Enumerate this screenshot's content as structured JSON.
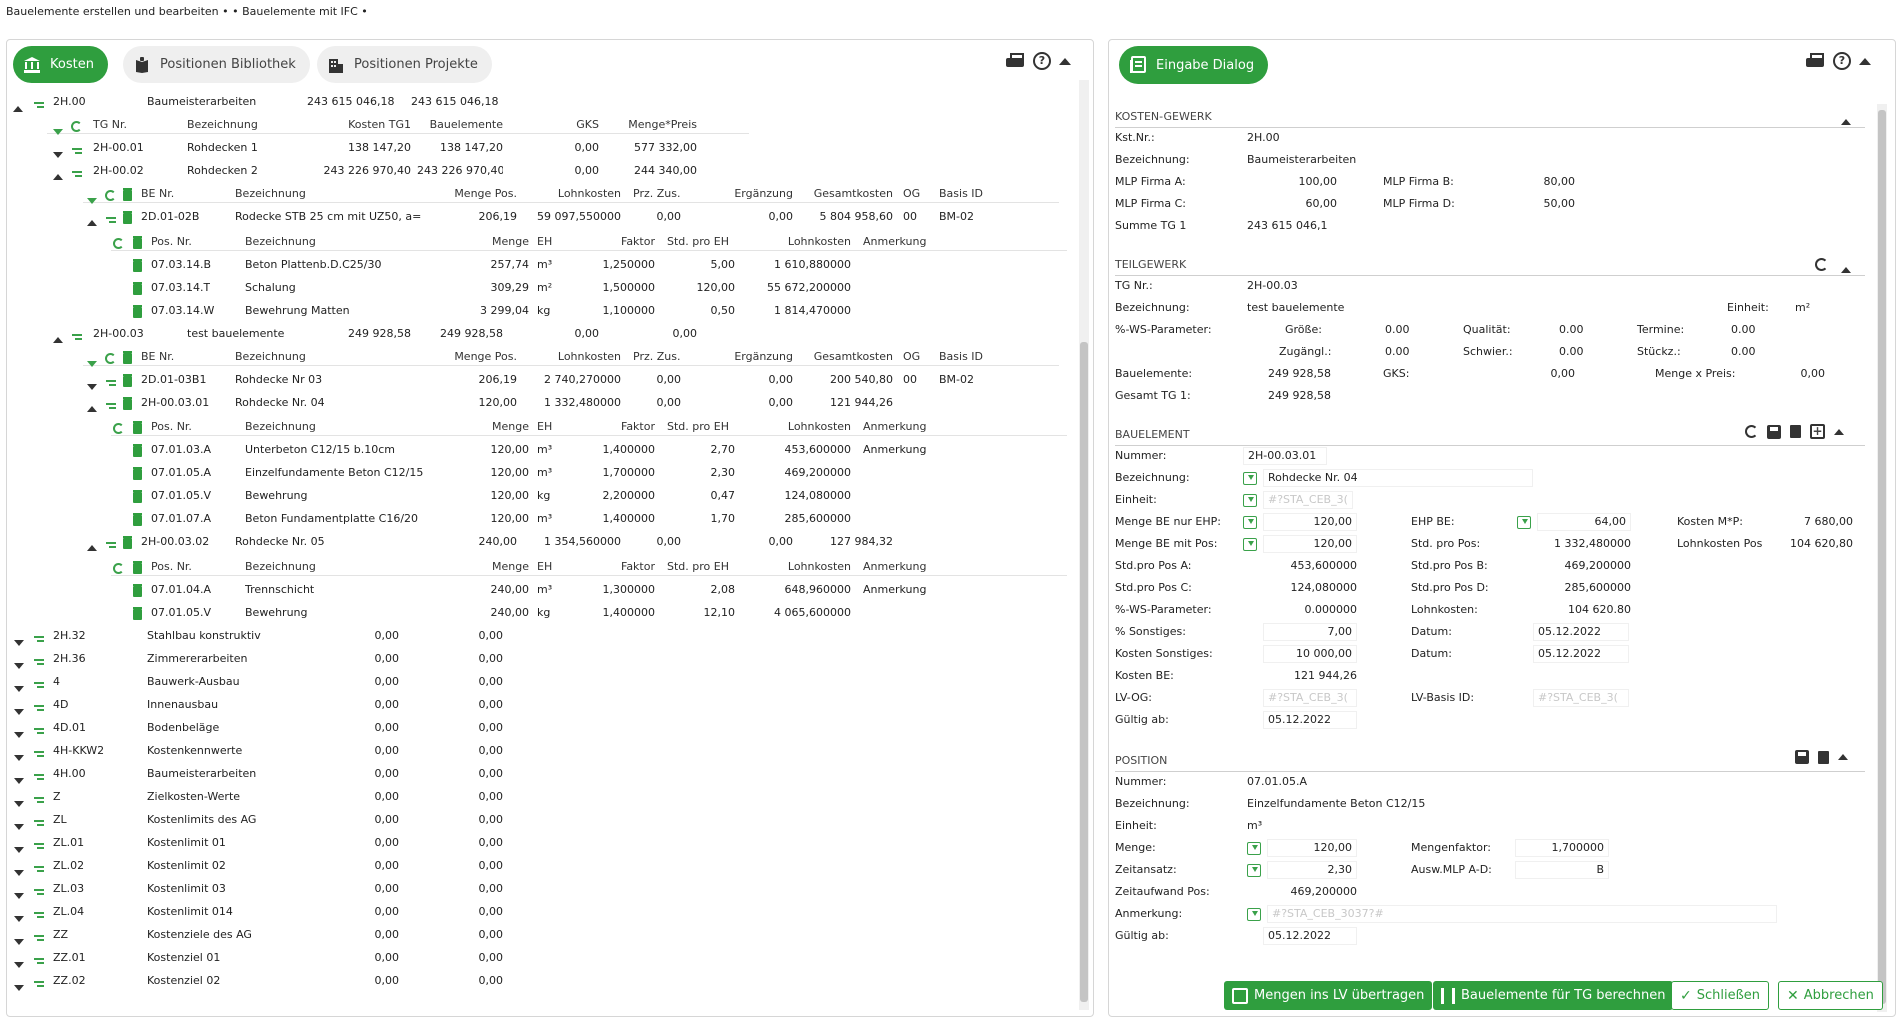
{
  "window": {
    "title": "Bauelemente erstellen und bearbeiten •  • Bauelemente mit IFC •"
  },
  "colors": {
    "accent": "#2f9e3e"
  },
  "left": {
    "tabs": [
      {
        "label": "Kosten",
        "icon": "bank-icon",
        "active": true
      },
      {
        "label": "Positionen Bibliothek",
        "icon": "book-icon",
        "active": false
      },
      {
        "label": "Positionen Projekte",
        "icon": "building-icon",
        "active": false
      }
    ],
    "root": {
      "id": "2H.00",
      "name": "Baumeisterarbeiten",
      "kosten": "243 615 046,18",
      "bauelemente": "243 615 046,18"
    },
    "tg_header": {
      "tg_nr": "TG Nr.",
      "bez": "Bezeichnung",
      "kosten": "Kosten TG1",
      "be": "Bauelemente",
      "gks": "GKS",
      "mp": "Menge*Preis"
    },
    "tg": [
      {
        "nr": "2H-00.01",
        "bez": "Rohdecken 1",
        "kosten": "138 147,20",
        "be": "138 147,20",
        "gks": "0,00",
        "mp": "577 332,00"
      },
      {
        "nr": "2H-00.02",
        "bez": "Rohdecken 2",
        "kosten": "243 226 970,40",
        "be": "243 226 970,40",
        "gks": "0,00",
        "mp": "244 340,00"
      },
      {
        "nr": "2H-00.03",
        "bez": "test bauelemente",
        "kosten": "249 928,58",
        "be": "249 928,58",
        "gks": "0,00",
        "mp": "0,00"
      }
    ],
    "be_header": {
      "nr": "BE Nr.",
      "bez": "Bezeichnung",
      "menge": "Menge Pos.",
      "lohn": "Lohnkosten",
      "prz": "Prz. Zus.",
      "erg": "Ergänzung",
      "ges": "Gesamtkosten",
      "og": "OG",
      "basis": "Basis ID"
    },
    "pos_header": {
      "nr": "Pos. Nr.",
      "bez": "Bezeichnung",
      "menge": "Menge",
      "eh": "EH",
      "faktor": "Faktor",
      "std": "Std. pro EH",
      "lohn": "Lohnkosten",
      "anm": "Anmerkung"
    },
    "be_a": {
      "nr": "2D.01-02B",
      "bez": "Rodecke STB 25 cm mit UZ50, a=",
      "menge": "206,19",
      "lohn": "59 097,550000",
      "prz": "0,00",
      "erg": "0,00",
      "ges": "5 804 958,60",
      "og": "00",
      "basis": "BM-02"
    },
    "pos_a": [
      {
        "nr": "07.03.14.B",
        "bez": "Beton Plattenb.D.C25/30",
        "menge": "257,74",
        "eh": "m³",
        "faktor": "1,250000",
        "std": "5,00",
        "lohn": "1 610,880000",
        "anm": ""
      },
      {
        "nr": "07.03.14.T",
        "bez": "Schalung",
        "menge": "309,29",
        "eh": "m²",
        "faktor": "1,500000",
        "std": "120,00",
        "lohn": "55 672,200000",
        "anm": ""
      },
      {
        "nr": "07.03.14.W",
        "bez": "Bewehrung Matten",
        "menge": "3 299,04",
        "eh": "kg",
        "faktor": "1,100000",
        "std": "0,50",
        "lohn": "1 814,470000",
        "anm": ""
      }
    ],
    "be_b": [
      {
        "nr": "2D.01-03B1",
        "bez": "Rohdecke Nr 03",
        "menge": "206,19",
        "lohn": "2 740,270000",
        "prz": "0,00",
        "erg": "0,00",
        "ges": "200 540,80",
        "og": "00",
        "basis": "BM-02"
      },
      {
        "nr": "2H-00.03.01",
        "bez": "Rohdecke Nr. 04",
        "menge": "120,00",
        "lohn": "1 332,480000",
        "prz": "0,00",
        "erg": "0,00",
        "ges": "121 944,26",
        "og": "",
        "basis": ""
      }
    ],
    "pos_b": [
      {
        "nr": "07.01.03.A",
        "bez": "Unterbeton C12/15 b.10cm",
        "menge": "120,00",
        "eh": "m³",
        "faktor": "1,400000",
        "std": "2,70",
        "lohn": "453,600000",
        "anm": "Anmerkung"
      },
      {
        "nr": "07.01.05.A",
        "bez": "Einzelfundamente Beton C12/15",
        "menge": "120,00",
        "eh": "m³",
        "faktor": "1,700000",
        "std": "2,30",
        "lohn": "469,200000",
        "anm": ""
      },
      {
        "nr": "07.01.05.V",
        "bez": "Bewehrung",
        "menge": "120,00",
        "eh": "kg",
        "faktor": "2,200000",
        "std": "0,47",
        "lohn": "124,080000",
        "anm": ""
      },
      {
        "nr": "07.01.07.A",
        "bez": "Beton Fundamentplatte C16/20",
        "menge": "120,00",
        "eh": "m³",
        "faktor": "1,400000",
        "std": "1,70",
        "lohn": "285,600000",
        "anm": ""
      }
    ],
    "be_c": {
      "nr": "2H-00.03.02",
      "bez": "Rohdecke Nr. 05",
      "menge": "240,00",
      "lohn": "1 354,560000",
      "prz": "0,00",
      "erg": "0,00",
      "ges": "127 984,32",
      "og": "",
      "basis": ""
    },
    "pos_c": [
      {
        "nr": "07.01.04.A",
        "bez": "Trennschicht",
        "menge": "240,00",
        "eh": "m³",
        "faktor": "1,300000",
        "std": "2,08",
        "lohn": "648,960000",
        "anm": "Anmerkung"
      },
      {
        "nr": "07.01.05.V",
        "bez": "Bewehrung",
        "menge": "240,00",
        "eh": "kg",
        "faktor": "1,400000",
        "std": "12,10",
        "lohn": "4 065,600000",
        "anm": ""
      }
    ],
    "groups": [
      {
        "id": "2H.32",
        "name": "Stahlbau konstruktiv",
        "a": "0,00",
        "b": "0,00"
      },
      {
        "id": "2H.36",
        "name": "Zimmererarbeiten",
        "a": "0,00",
        "b": "0,00"
      },
      {
        "id": "4",
        "name": "Bauwerk-Ausbau",
        "a": "0,00",
        "b": "0,00"
      },
      {
        "id": "4D",
        "name": "Innenausbau",
        "a": "0,00",
        "b": "0,00"
      },
      {
        "id": "4D.01",
        "name": "Bodenbeläge",
        "a": "0,00",
        "b": "0,00"
      },
      {
        "id": "4H-KKW2",
        "name": "Kostenkennwerte",
        "a": "0,00",
        "b": "0,00"
      },
      {
        "id": "4H.00",
        "name": "Baumeisterarbeiten",
        "a": "0,00",
        "b": "0,00"
      },
      {
        "id": "Z",
        "name": "Zielkosten-Werte",
        "a": "0,00",
        "b": "0,00"
      },
      {
        "id": "ZL",
        "name": "Kostenlimits des AG",
        "a": "0,00",
        "b": "0,00"
      },
      {
        "id": "ZL.01",
        "name": "Kostenlimit 01",
        "a": "0,00",
        "b": "0,00"
      },
      {
        "id": "ZL.02",
        "name": "Kostenlimit 02",
        "a": "0,00",
        "b": "0,00"
      },
      {
        "id": "ZL.03",
        "name": "Kostenlimit 03",
        "a": "0,00",
        "b": "0,00"
      },
      {
        "id": "ZL.04",
        "name": "Kostenlimit 014",
        "a": "0,00",
        "b": "0,00"
      },
      {
        "id": "ZZ",
        "name": "Kostenziele des AG",
        "a": "0,00",
        "b": "0,00"
      },
      {
        "id": "ZZ.01",
        "name": "Kostenziel 01",
        "a": "0,00",
        "b": "0,00"
      },
      {
        "id": "ZZ.02",
        "name": "Kostenziel 02",
        "a": "0,00",
        "b": "0,00"
      }
    ]
  },
  "right": {
    "eingabe_label": "Eingabe Dialog",
    "kosten_gewerk": {
      "title": "KOSTEN-GEWERK",
      "kst_label": "Kst.Nr.:",
      "kst": "2H.00",
      "bez_label": "Bezeichnung:",
      "bez": "Baumeisterarbeiten",
      "mlp_a_label": "MLP Firma A:",
      "mlp_a": "100,00",
      "mlp_b_label": "MLP Firma B:",
      "mlp_b": "80,00",
      "mlp_c_label": "MLP Firma C:",
      "mlp_c": "60,00",
      "mlp_d_label": "MLP Firma D:",
      "mlp_d": "50,00",
      "summe_label": "Summe TG 1",
      "summe": "243 615 046,1"
    },
    "teilgewerk": {
      "title": "TEILGEWERK",
      "tg_label": "TG Nr.:",
      "tg": "2H-00.03",
      "bez_label": "Bezeichnung:",
      "bez": "test bauelemente",
      "einheit_label": "Einheit:",
      "einheit": "m²",
      "ws_label": "%-WS-Parameter:",
      "groesse_label": "Größe:",
      "groesse": "0.00",
      "qual_label": "Qualität:",
      "qual": "0.00",
      "termine_label": "Termine:",
      "termine": "0.00",
      "zugang_label": "Zugängl.:",
      "zugang": "0.00",
      "schwier_label": "Schwier.:",
      "schwier": "0.00",
      "stueckz_label": "Stückz.:",
      "stueckz": "0.00",
      "be_label": "Bauelemente:",
      "be": "249 928,58",
      "gks_label": "GKS:",
      "gks": "0,00",
      "mxp_label": "Menge x Preis:",
      "mxp": "0,00",
      "ges_label": "Gesamt TG 1:",
      "ges": "249 928,58"
    },
    "bauelement": {
      "title": "BAUELEMENT",
      "nummer_label": "Nummer:",
      "nummer": "2H-00.03.01",
      "bez_label": "Bezeichnung:",
      "bez": "Rohdecke Nr. 04",
      "einheit_label": "Einheit:",
      "einheit_ph": "#?STA_CEB_3(",
      "mbe_ehp_label": "Menge BE nur EHP:",
      "mbe_ehp": "120,00",
      "ehp_be_label": "EHP BE:",
      "ehp_be": "64,00",
      "kosten_mp_label": "Kosten M*P:",
      "kosten_mp": "7 680,00",
      "mbe_pos_label": "Menge BE mit Pos:",
      "mbe_pos": "120,00",
      "std_pos_label": "Std. pro Pos:",
      "std_pos": "1 332,480000",
      "lohn_pos_label": "Lohnkosten Pos",
      "lohn_pos": "104 620,80",
      "std_a_label": "Std.pro Pos A:",
      "std_a": "453,600000",
      "std_b_label": "Std.pro Pos B:",
      "std_b": "469,200000",
      "std_c_label": "Std.pro Pos C:",
      "std_c": "124,080000",
      "std_d_label": "Std.pro Pos D:",
      "std_d": "285,600000",
      "ws_label": "%-WS-Parameter:",
      "ws": "0.000000",
      "lohn_label": "Lohnkosten:",
      "lohn": "104 620.80",
      "sonst_label": "% Sonstiges:",
      "sonst": "7,00",
      "datum1_label": "Datum:",
      "datum1": "05.12.2022",
      "ksonst_label": "Kosten Sonstiges:",
      "ksonst": "10 000,00",
      "datum2_label": "Datum:",
      "datum2": "05.12.2022",
      "kbe_label": "Kosten BE:",
      "kbe": "121 944,26",
      "lvog_label": "LV-OG:",
      "lvog_ph": "#?STA_CEB_3(",
      "lvbasis_label": "LV-Basis ID:",
      "lvbasis_ph": "#?STA_CEB_3(",
      "gueltig_label": "Gültig ab:",
      "gueltig": "05.12.2022"
    },
    "position": {
      "title": "POSITION",
      "nummer_label": "Nummer:",
      "nummer": "07.01.05.A",
      "bez_label": "Bezeichnung:",
      "bez": "Einzelfundamente Beton C12/15",
      "einheit_label": "Einheit:",
      "einheit": "m³",
      "menge_label": "Menge:",
      "menge": "120,00",
      "mfaktor_label": "Mengenfaktor:",
      "mfaktor": "1,700000",
      "zeitansatz_label": "Zeitansatz:",
      "zeitansatz": "2,30",
      "ausw_label": "Ausw.MLP A-D:",
      "ausw": "B",
      "zeitaufwand_label": "Zeitaufwand Pos:",
      "zeitaufwand": "469,200000",
      "anm_label": "Anmerkung:",
      "anm_ph": "#?STA_CEB_3037?#",
      "gueltig_label": "Gültig ab:",
      "gueltig": "05.12.2022"
    },
    "footer": {
      "mengen": "Mengen ins LV übertragen",
      "berechnen": "Bauelemente für TG berechnen",
      "schliessen": "Schließen",
      "abbrechen": "Abbrechen"
    }
  }
}
